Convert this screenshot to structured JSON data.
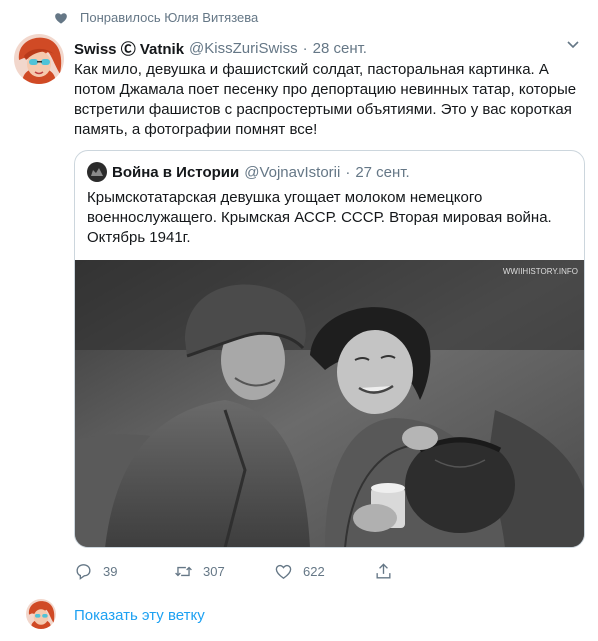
{
  "social_context": {
    "label": "Понравилось Юлия Витязева"
  },
  "tweet": {
    "author_name": "Swiss Ⓒ Vatnik",
    "author_handle": "@KissZuriSwiss",
    "separator": "·",
    "date": "28 сент.",
    "text": "Как мило, девушка и фашистский солдат, пасторальная картинка. А потом Джамала поет песенку про депортацию невинных татар, которые встретили фашистов с распростертыми объятиями. Это у вас короткая память, а фотографии помнят все!"
  },
  "quoted_tweet": {
    "author_name": "Война в Истории",
    "author_handle": "@VojnavIstorii",
    "separator": "·",
    "date": "27 сент.",
    "text": "Крымскотатарская девушка угощает молоком немецкого военнослужащего. Крымская АССР. СССР. Вторая мировая война. Октябрь 1941г.",
    "photo_watermark": "WWIIHISTORY.INFO"
  },
  "actions": {
    "reply_count": "39",
    "retweet_count": "307",
    "like_count": "622"
  },
  "thread": {
    "show_thread_label": "Показать эту ветку"
  },
  "colors": {
    "accent": "#1da1f2",
    "muted": "#657786",
    "text": "#14171a",
    "border": "#ccd6dd"
  },
  "icons": [
    "heart-icon",
    "chevron-down-icon",
    "reply-icon",
    "retweet-icon",
    "like-icon",
    "share-icon"
  ]
}
